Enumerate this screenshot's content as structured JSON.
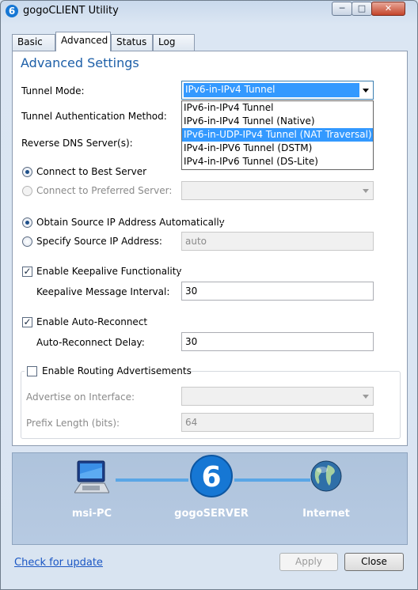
{
  "window": {
    "title": "gogoCLIENT Utility",
    "icon_glyph": "6",
    "min_glyph": "─",
    "max_glyph": "□",
    "close_glyph": "✕"
  },
  "tabs": [
    {
      "label": "Basic"
    },
    {
      "label": "Advanced",
      "active": true
    },
    {
      "label": "Status"
    },
    {
      "label": "Log"
    }
  ],
  "advanced": {
    "heading": "Advanced Settings",
    "tunnel_mode": {
      "label": "Tunnel Mode:",
      "selected": "IPv6-in-IPv4 Tunnel",
      "options": [
        "IPv6-in-IPv4 Tunnel",
        "IPv6-in-IPv4 Tunnel (Native)",
        "IPv6-in-UDP-IPv4 Tunnel (NAT Traversal)",
        "IPv4-in-IPV6 Tunnel (DSTM)",
        "IPv4-in-IPv6 Tunnel (DS-Lite)"
      ],
      "highlighted_index": 2
    },
    "auth_label": "Tunnel Authentication Method:",
    "reverse_dns_label": "Reverse DNS Server(s):",
    "server": {
      "best_label": "Connect to Best Server",
      "preferred_label": "Connect to Preferred Server:",
      "preferred_value": ""
    },
    "source_ip": {
      "auto_label": "Obtain Source IP Address Automatically",
      "specify_label": "Specify Source IP Address:",
      "value": "auto"
    },
    "keepalive": {
      "enable_label": "Enable Keepalive Functionality",
      "enabled": true,
      "interval_label": "Keepalive Message Interval:",
      "interval_value": "30"
    },
    "reconnect": {
      "enable_label": "Enable Auto-Reconnect",
      "enabled": true,
      "delay_label": "Auto-Reconnect Delay:",
      "delay_value": "30"
    },
    "routing": {
      "enable_label": "Enable Routing Advertisements",
      "enabled": false,
      "interface_label": "Advertise on Interface:",
      "interface_value": "",
      "prefix_label": "Prefix Length (bits):",
      "prefix_value": "64"
    },
    "check_glyph": "✓"
  },
  "diagram": {
    "nodes": [
      {
        "label": "msi-PC",
        "icon": "computer-icon"
      },
      {
        "label": "gogoSERVER",
        "icon": "gogo-logo-icon",
        "glyph": "6"
      },
      {
        "label": "Internet",
        "icon": "globe-icon"
      }
    ]
  },
  "footer": {
    "update_link": "Check for update",
    "apply_label": "Apply",
    "close_label": "Close"
  },
  "colors": {
    "accent": "#1d5fa8",
    "highlight": "#3399ff",
    "diagram_bg": "#aec3dc",
    "logo_blue": "#1677d4"
  }
}
